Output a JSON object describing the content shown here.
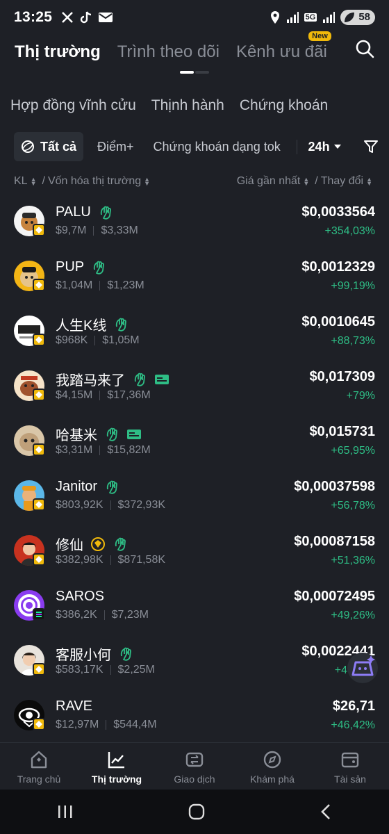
{
  "status_bar": {
    "time": "13:25",
    "battery": "58",
    "network": "5G"
  },
  "top_tabs": [
    {
      "label": "Thị trường",
      "active": true
    },
    {
      "label": "Trình theo dõi",
      "active": false
    },
    {
      "label": "Kênh ưu đãi",
      "active": false,
      "badge": "New"
    }
  ],
  "category_tabs": [
    "Hợp đồng vĩnh cửu",
    "Thịnh hành",
    "Chứng khoán"
  ],
  "filters": {
    "all_label": "Tất cả",
    "chip_points": "Điểm+",
    "chip_tokenized": "Chứng khoán dạng tok",
    "period": "24h"
  },
  "columns": {
    "left": "KL",
    "left_sep": "/",
    "left_2": "Vốn hóa thị trường",
    "right": "Giá gần nhất",
    "right_sep": "/",
    "right_2": "Thay đổi"
  },
  "tokens": [
    {
      "name": "PALU",
      "volume": "$9,7M",
      "mcap": "$3,33M",
      "price": "$0,0033564",
      "change": "+354,03%",
      "chain": "bnb"
    },
    {
      "name": "PUP",
      "volume": "$1,04M",
      "mcap": "$1,23M",
      "price": "$0,0012329",
      "change": "+99,19%",
      "chain": "bnb"
    },
    {
      "name": "人生K线",
      "volume": "$968K",
      "mcap": "$1,05M",
      "price": "$0,0010645",
      "change": "+88,73%",
      "chain": "bnb"
    },
    {
      "name": "我踏马来了",
      "volume": "$4,15M",
      "mcap": "$17,36M",
      "price": "$0,017309",
      "change": "+79%",
      "chain": "bnb"
    },
    {
      "name": "哈基米",
      "volume": "$3,31M",
      "mcap": "$15,82M",
      "price": "$0,015731",
      "change": "+65,95%",
      "chain": "bnb"
    },
    {
      "name": "Janitor",
      "volume": "$803,92K",
      "mcap": "$372,93K",
      "price": "$0,00037598",
      "change": "+56,78%",
      "chain": "bnb"
    },
    {
      "name": "修仙",
      "volume": "$382,98K",
      "mcap": "$871,58K",
      "price": "$0,00087158",
      "change": "+51,36%",
      "chain": "bnb"
    },
    {
      "name": "SAROS",
      "volume": "$386,2K",
      "mcap": "$7,23M",
      "price": "$0,00072495",
      "change": "+49,26%",
      "chain": "sol"
    },
    {
      "name": "客服小何",
      "volume": "$583,17K",
      "mcap": "$2,25M",
      "price": "$0,0022441",
      "change": "+4",
      "chain": "bnb"
    },
    {
      "name": "RAVE",
      "volume": "$12,97M",
      "mcap": "$544,4M",
      "price": "$26,71",
      "change": "+46,42%",
      "chain": "bnb"
    }
  ],
  "bottom_nav": [
    {
      "label": "Trang chủ",
      "icon": "home-icon"
    },
    {
      "label": "Thị trường",
      "icon": "chart-icon",
      "active": true
    },
    {
      "label": "Giao dịch",
      "icon": "trade-icon"
    },
    {
      "label": "Khám phá",
      "icon": "compass-icon"
    },
    {
      "label": "Tài sản",
      "icon": "wallet-icon"
    }
  ],
  "colors": {
    "background": "#1e2026",
    "up_green": "#2ebd85",
    "accent_yellow": "#f0b90b",
    "muted_text": "#8a8e97"
  }
}
